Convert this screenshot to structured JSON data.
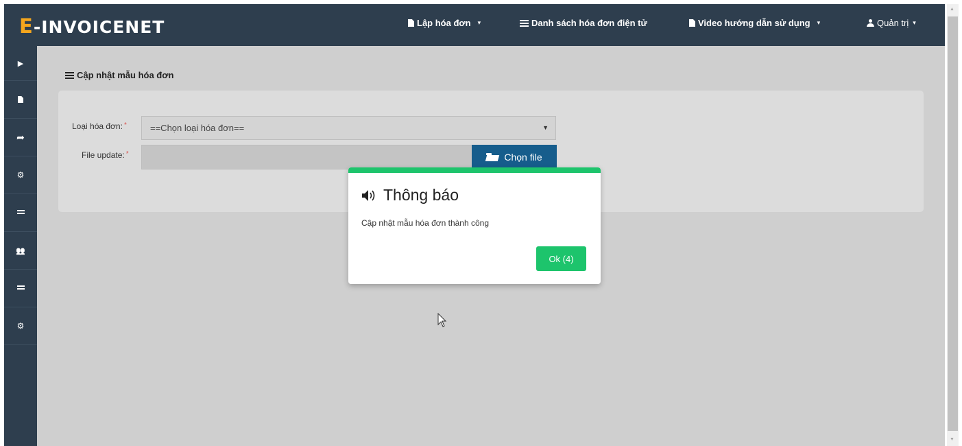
{
  "brand": {
    "logo_e": "E",
    "logo_rest": "-INVOICENET",
    "accent": "#f5a61d"
  },
  "navbar": {
    "bg": "#2e3e4e",
    "items": [
      {
        "label": "Lập hóa đơn",
        "icon": "document-icon",
        "caret": "▾"
      },
      {
        "label": "Danh sách hóa đơn điện tử",
        "icon": "list-icon"
      },
      {
        "label": "Video hướng dẫn sử dụng",
        "icon": "document-icon",
        "caret": "▾"
      },
      {
        "label": "Quản trị",
        "icon": "user-icon",
        "caret": "▾"
      }
    ]
  },
  "sidebar": {
    "items": [
      {
        "icon": "play-icon",
        "glyph": "▶"
      },
      {
        "icon": "document-icon",
        "glyph": "🗎"
      },
      {
        "icon": "share-icon",
        "glyph": "➦"
      },
      {
        "icon": "cogs-icon",
        "glyph": "⚙"
      },
      {
        "icon": "list-icon",
        "glyph": "≡"
      },
      {
        "icon": "users-icon",
        "glyph": "👥"
      },
      {
        "icon": "list-icon",
        "glyph": "≡"
      },
      {
        "icon": "cogs-icon",
        "glyph": "⚙"
      }
    ]
  },
  "page": {
    "title": "Cập nhật mẫu hóa đơn"
  },
  "form": {
    "invoice_type_label": "Loại hóa đơn:",
    "invoice_type_value": "==Chọn loại hóa đơn==",
    "file_label": "File update:",
    "file_value": "",
    "choose_file_label": "Chọn file",
    "required_mark": "*"
  },
  "dialog": {
    "title": "Thông báo",
    "icon": "volume-icon",
    "message": "Cập nhật mẫu hóa đơn thành công",
    "ok_label": "Ok (4)",
    "accent": "#1dc46c"
  }
}
